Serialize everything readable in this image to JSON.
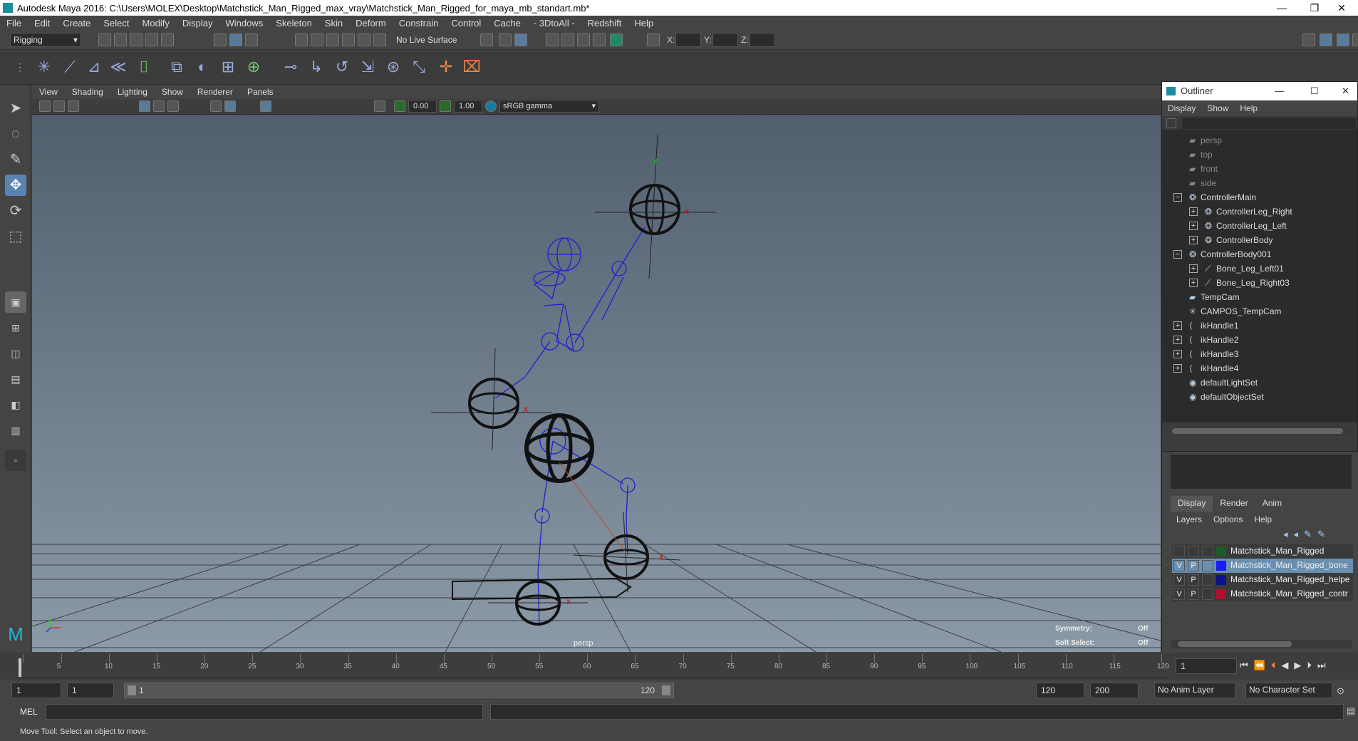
{
  "window": {
    "title": "Autodesk Maya 2016: C:\\Users\\MOLEX\\Desktop\\Matchstick_Man_Rigged_max_vray\\Matchstick_Man_Rigged_for_maya_mb_standart.mb*"
  },
  "menubar": [
    "File",
    "Edit",
    "Create",
    "Select",
    "Modify",
    "Display",
    "Windows",
    "Skeleton",
    "Skin",
    "Deform",
    "Constrain",
    "Control",
    "Cache",
    "- 3DtoAll -",
    "Redshift",
    "Help"
  ],
  "shelf": {
    "mode": "Rigging",
    "live_surface": "No Live Surface",
    "x_label": "X:",
    "y_label": "Y:",
    "z_label": "Z:"
  },
  "viewport": {
    "menu": [
      "View",
      "Shading",
      "Lighting",
      "Show",
      "Renderer",
      "Panels"
    ],
    "exposure": "0.00",
    "gamma": "1.00",
    "color_space": "sRGB gamma",
    "camera_label": "persp",
    "symmetry_label": "Symmetry:",
    "symmetry_value": "Off",
    "soft_select_label": "Soft Select:",
    "soft_select_value": "Off"
  },
  "outliner": {
    "title": "Outliner",
    "menu": [
      "Display",
      "Show",
      "Help"
    ],
    "items": [
      {
        "label": "persp",
        "indent": 0,
        "expand": "",
        "icon": "camera-icon",
        "dim": true
      },
      {
        "label": "top",
        "indent": 0,
        "expand": "",
        "icon": "camera-icon",
        "dim": true
      },
      {
        "label": "front",
        "indent": 0,
        "expand": "",
        "icon": "camera-icon",
        "dim": true
      },
      {
        "label": "side",
        "indent": 0,
        "expand": "",
        "icon": "camera-icon",
        "dim": true
      },
      {
        "label": "ControllerMain",
        "indent": 0,
        "expand": "−",
        "icon": "curve-icon",
        "dim": false
      },
      {
        "label": "ControllerLeg_Right",
        "indent": 1,
        "expand": "+",
        "icon": "curve-icon",
        "dim": false
      },
      {
        "label": "ControllerLeg_Left",
        "indent": 1,
        "expand": "+",
        "icon": "curve-icon",
        "dim": false
      },
      {
        "label": "ControllerBody",
        "indent": 1,
        "expand": "+",
        "icon": "curve-icon",
        "dim": false
      },
      {
        "label": "ControllerBody001",
        "indent": 0,
        "expand": "−",
        "icon": "curve-icon",
        "dim": false
      },
      {
        "label": "Bone_Leg_Left01",
        "indent": 1,
        "expand": "+",
        "icon": "joint-icon",
        "dim": false
      },
      {
        "label": "Bone_Leg_Right03",
        "indent": 1,
        "expand": "+",
        "icon": "joint-icon",
        "dim": false
      },
      {
        "label": "TempCam",
        "indent": 0,
        "expand": "",
        "icon": "camera-icon",
        "dim": false
      },
      {
        "label": "CAMPOS_TempCam",
        "indent": 0,
        "expand": "",
        "icon": "locator-icon",
        "dim": false
      },
      {
        "label": "ikHandle1",
        "indent": 0,
        "expand": "+",
        "icon": "ik-icon",
        "dim": false
      },
      {
        "label": "ikHandle2",
        "indent": 0,
        "expand": "+",
        "icon": "ik-icon",
        "dim": false
      },
      {
        "label": "ikHandle3",
        "indent": 0,
        "expand": "+",
        "icon": "ik-icon",
        "dim": false
      },
      {
        "label": "ikHandle4",
        "indent": 0,
        "expand": "+",
        "icon": "ik-icon",
        "dim": false
      },
      {
        "label": "defaultLightSet",
        "indent": 0,
        "expand": "",
        "icon": "set-icon",
        "dim": false
      },
      {
        "label": "defaultObjectSet",
        "indent": 0,
        "expand": "",
        "icon": "set-icon",
        "dim": false
      }
    ]
  },
  "layers": {
    "tabs": [
      "Display",
      "Render",
      "Anim"
    ],
    "menu": [
      "Layers",
      "Options",
      "Help"
    ],
    "rows": [
      {
        "v": "",
        "p": "",
        "color": "#1f5a2a",
        "name": "Matchstick_Man_Rigged",
        "selected": false
      },
      {
        "v": "V",
        "p": "P",
        "color": "#1a1aff",
        "name": "Matchstick_Man_Rigged_bone",
        "selected": true
      },
      {
        "v": "V",
        "p": "P",
        "color": "#11118a",
        "name": "Matchstick_Man_Rigged_helpe",
        "selected": false
      },
      {
        "v": "V",
        "p": "P",
        "color": "#b01030",
        "name": "Matchstick_Man_Rigged_contr",
        "selected": false
      }
    ]
  },
  "timeline": {
    "ticks": [
      "1",
      "5",
      "10",
      "15",
      "20",
      "25",
      "30",
      "35",
      "40",
      "45",
      "50",
      "55",
      "60",
      "65",
      "70",
      "75",
      "80",
      "85",
      "90",
      "95",
      "100",
      "105",
      "110",
      "115",
      "120"
    ],
    "current_frame": "1"
  },
  "range": {
    "start": "1",
    "current": "1",
    "slider_start": "1",
    "slider_end": "120",
    "end": "120",
    "max": "200",
    "anim_layer": "No Anim Layer",
    "character_set": "No Character Set"
  },
  "command": {
    "label": "MEL"
  },
  "status": {
    "text": "Move Tool: Select an object to move."
  }
}
